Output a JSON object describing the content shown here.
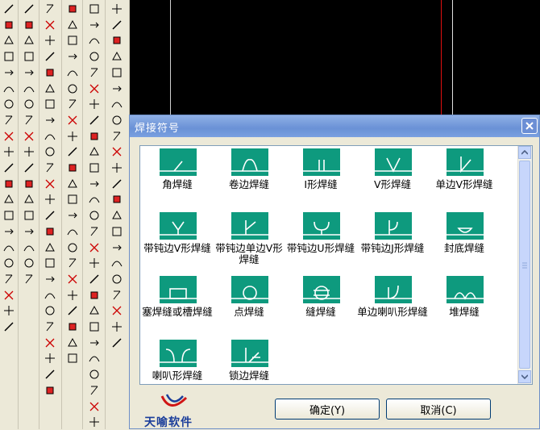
{
  "dialog": {
    "title": "焊接符号",
    "ok_label": "确定(Y)",
    "cancel_label": "取消(C)",
    "logo_text": "天喻软件"
  },
  "symbols": [
    {
      "label": "角焊缝"
    },
    {
      "label": "卷边焊缝"
    },
    {
      "label": "I形焊缝"
    },
    {
      "label": "V形焊缝"
    },
    {
      "label": "单边V形焊缝"
    },
    {
      "label": "带钝边V形焊缝"
    },
    {
      "label": "带钝边单边V形焊缝"
    },
    {
      "label": "带钝边U形焊缝"
    },
    {
      "label": "带钝边J形焊缝"
    },
    {
      "label": "封底焊缝"
    },
    {
      "label": "塞焊缝或槽焊缝"
    },
    {
      "label": "点焊缝"
    },
    {
      "label": "缝焊缝"
    },
    {
      "label": "单边喇叭形焊缝"
    },
    {
      "label": "堆焊缝"
    },
    {
      "label": "喇叭形焊缝"
    },
    {
      "label": "锁边焊缝"
    }
  ],
  "colors": {
    "symbol_bg": "#0e9a7e",
    "symbol_line": "#ffffff",
    "titlebar": "#7aa0e0"
  }
}
